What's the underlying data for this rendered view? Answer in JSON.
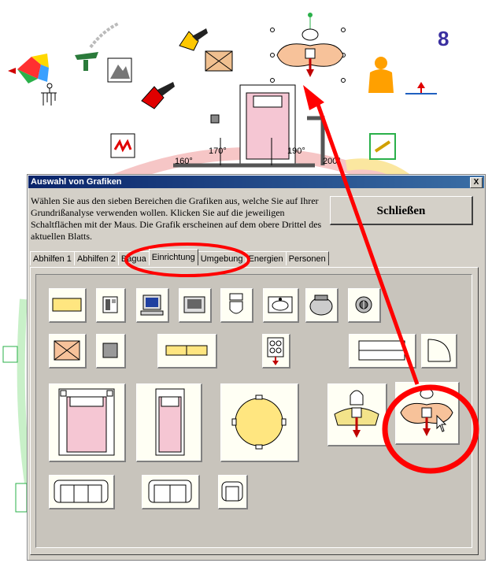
{
  "canvas": {
    "number_badge": "8",
    "angles": [
      "160°",
      "170°",
      "190°",
      "200°"
    ]
  },
  "dialog": {
    "title": "Auswahl von Grafiken",
    "close_x": "X",
    "description": "Wählen Sie aus den sieben Bereichen die Grafiken aus, welche Sie auf Ihrer Grundrißanalyse verwenden wollen. Klicken Sie auf die jeweiligen Schaltflächen mit der Maus. Die Grafik erscheinen auf dem obere Drittel des aktuellen Blatts.",
    "close_button": "Schließen",
    "tabs": [
      "Abhilfen 1",
      "Abhilfen 2",
      "Bagua",
      "Einrichtung",
      "Umgebung",
      "Energien",
      "Personen"
    ],
    "active_tab": "Einrichtung"
  },
  "colors": {
    "annotation_red": "#ff0000",
    "dialog_bg": "#d4d0c8",
    "title_blue": "#0a246a"
  },
  "icons": [
    "yellow-rect-icon",
    "phone-icon",
    "computer-icon",
    "tv-icon",
    "toilet-icon",
    "sink-icon",
    "pot-icon",
    "safe-icon",
    "crossed-box-icon",
    "gray-square-icon",
    "yellow-bench-icon",
    "stove-icon",
    "shelf-icon",
    "door-icon",
    "double-bed-icon",
    "single-bed-icon",
    "round-table-icon",
    "armchair-icon",
    "person-desk-icon",
    "sofa-large-icon",
    "sofa-small-icon",
    "armchair-small-icon"
  ]
}
